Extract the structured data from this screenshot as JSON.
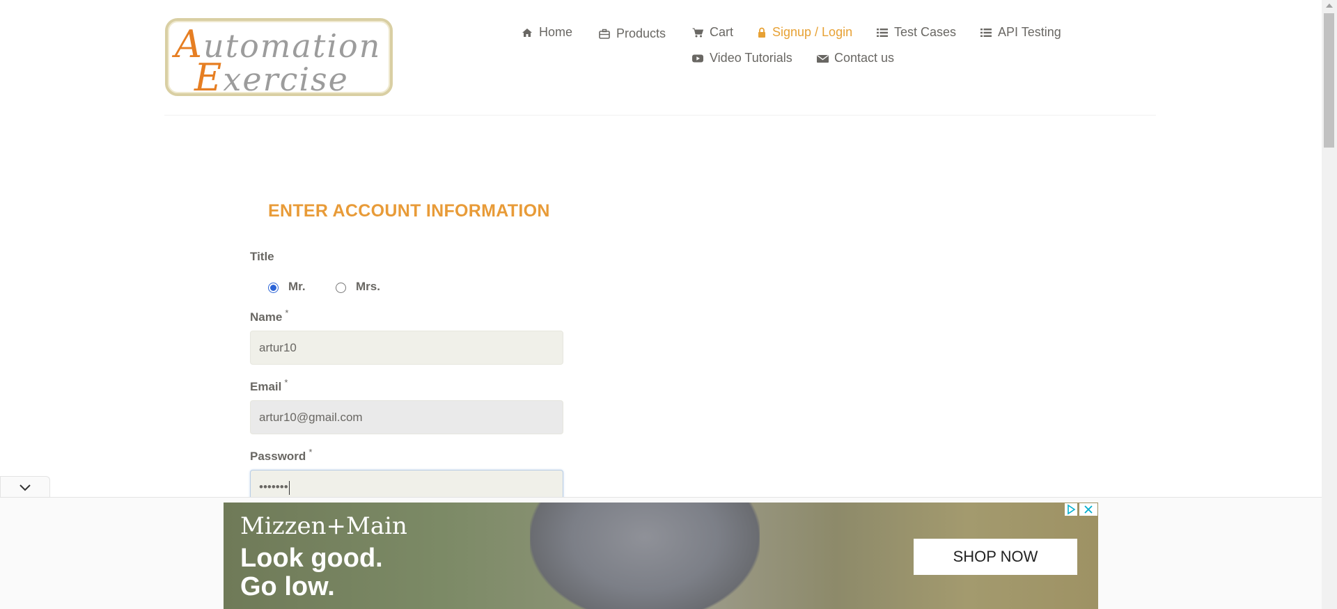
{
  "logo": {
    "line1_cap": "A",
    "line1_rest": "utomation",
    "line2_cap": "E",
    "line2_rest": "xercise"
  },
  "nav": {
    "items": [
      {
        "label": "Home",
        "icon": "home-icon"
      },
      {
        "label": "Products",
        "icon": "products-icon"
      },
      {
        "label": "Cart",
        "icon": "cart-icon"
      },
      {
        "label": "Signup / Login",
        "icon": "lock-icon",
        "active": true
      },
      {
        "label": "Test Cases",
        "icon": "list-icon"
      },
      {
        "label": "API Testing",
        "icon": "list-icon"
      },
      {
        "label": "Video Tutorials",
        "icon": "youtube-icon"
      },
      {
        "label": "Contact us",
        "icon": "envelope-icon"
      }
    ]
  },
  "form": {
    "heading": "ENTER ACCOUNT INFORMATION",
    "title_label": "Title",
    "title_options": [
      {
        "label": "Mr.",
        "selected": true
      },
      {
        "label": "Mrs.",
        "selected": false
      }
    ],
    "name_label": "Name",
    "name_value": "artur10",
    "email_label": "Email",
    "email_value": "artur10@gmail.com",
    "password_label": "Password",
    "password_value": "•••••••",
    "required_mark": "*"
  },
  "ad": {
    "brand": "Mizzen+Main",
    "slogan_line1": "Look good.",
    "slogan_line2": "Go low.",
    "cta": "SHOP NOW"
  },
  "colors": {
    "accent": "#e7a134",
    "heading": "#e89b38",
    "text": "#696763",
    "radio_checked": "#2a63d6"
  }
}
